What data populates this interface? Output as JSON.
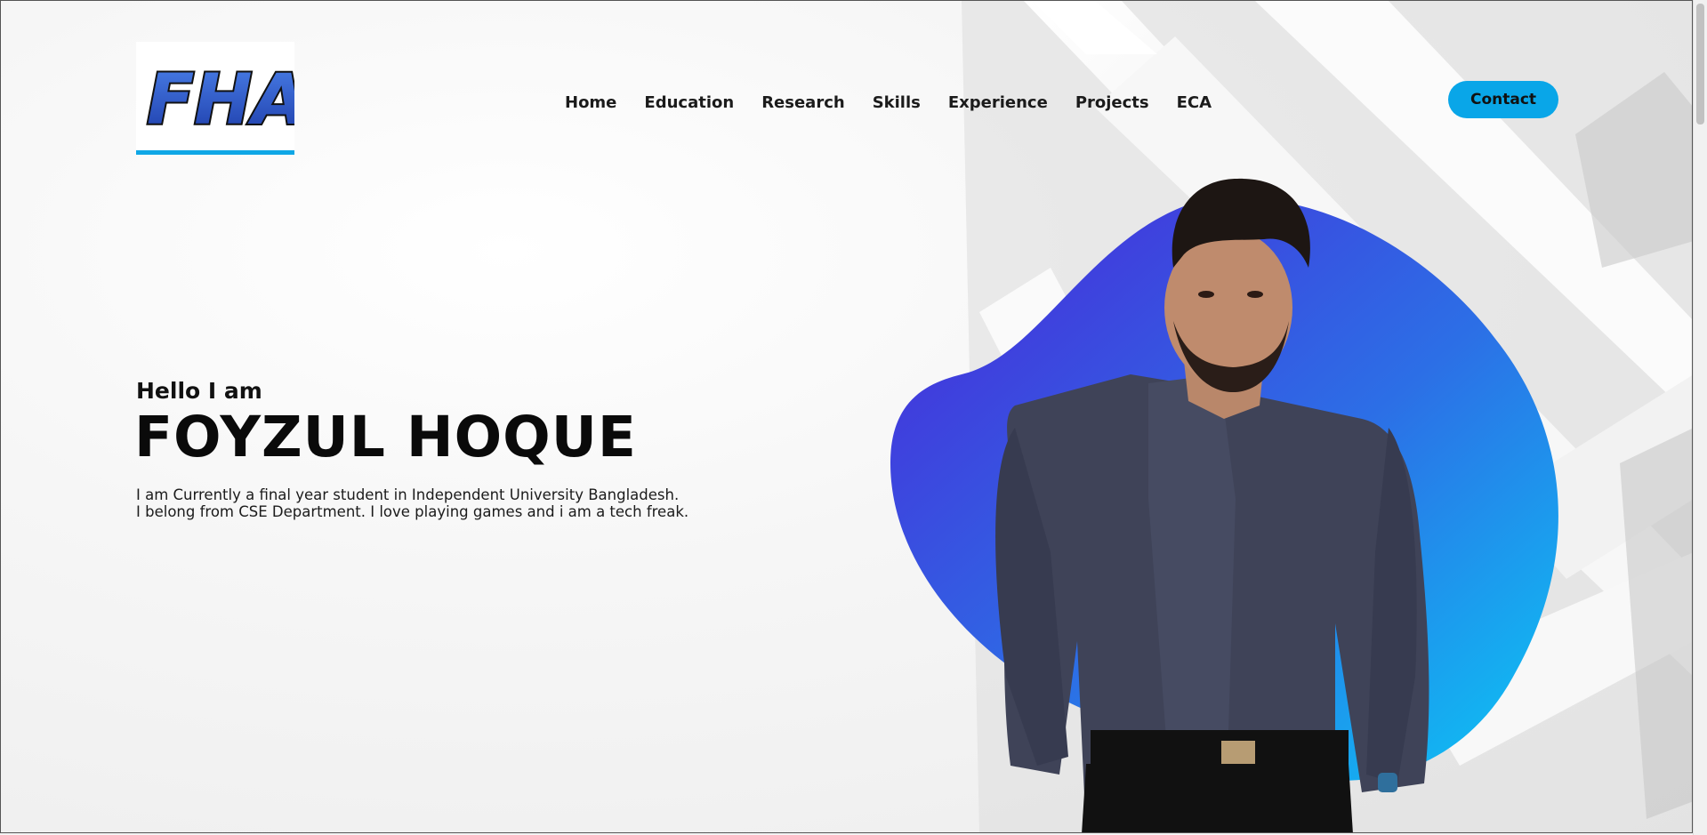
{
  "logo": {
    "text": "FHA"
  },
  "nav": {
    "items": [
      {
        "label": "Home"
      },
      {
        "label": "Education"
      },
      {
        "label": "Research"
      },
      {
        "label": "Skills"
      },
      {
        "label": "Experience"
      },
      {
        "label": "Projects"
      },
      {
        "label": "ECA"
      }
    ],
    "contact_label": "Contact"
  },
  "hero": {
    "greeting": "Hello I am",
    "name": "FOYZUL HOQUE",
    "description_line1": "I am Currently a final year student in Independent University Bangladesh.",
    "description_line2": "I belong from CSE Department. I love playing games and i am a tech freak."
  },
  "colors": {
    "accent": "#09a6e8",
    "blob_start": "#4a2ad9",
    "blob_end": "#0cc4f3",
    "shirt": "#3f4358"
  }
}
